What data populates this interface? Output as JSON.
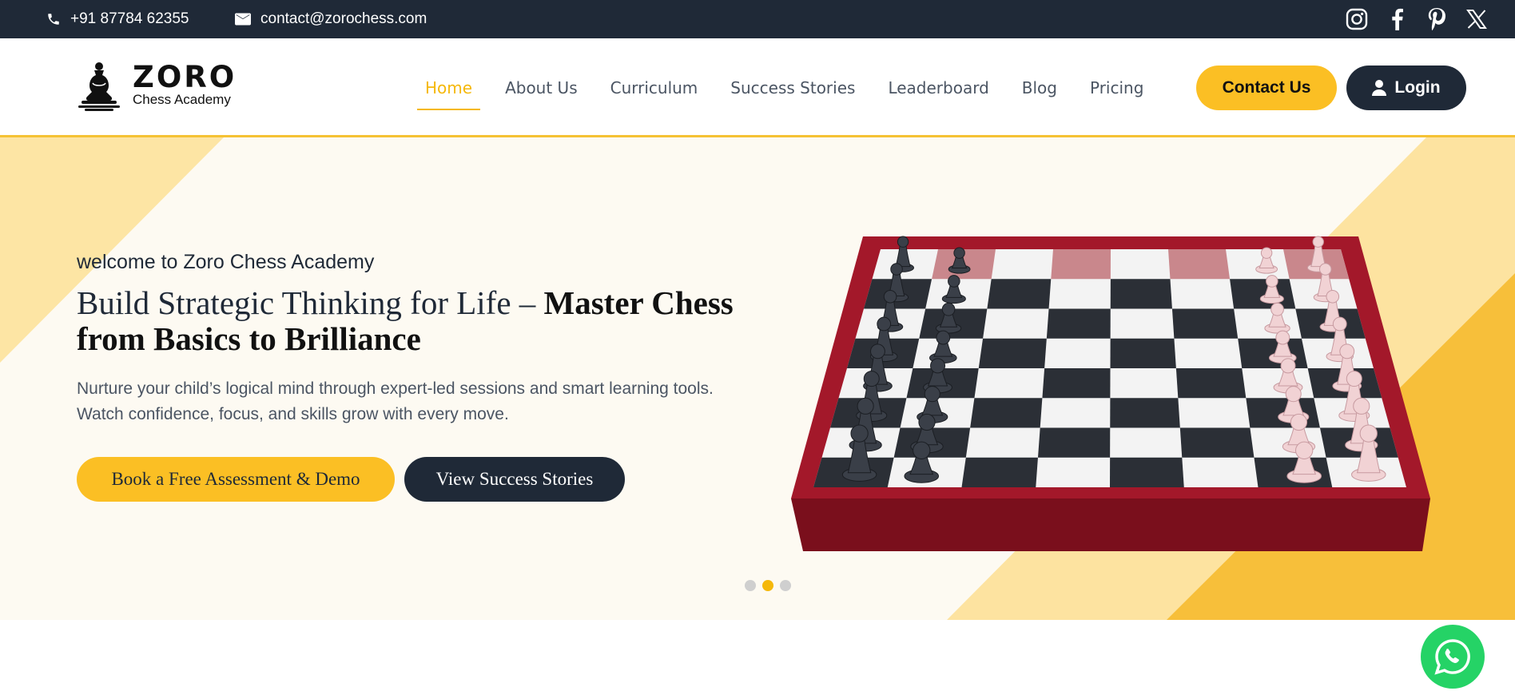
{
  "topbar": {
    "phone": "+91 87784 62355",
    "email": "contact@zorochess.com",
    "socials": [
      "instagram-icon",
      "facebook-icon",
      "pinterest-icon",
      "x-icon"
    ]
  },
  "brand": {
    "name": "ZORO",
    "subtitle": "Chess Academy"
  },
  "nav": {
    "items": [
      {
        "label": "Home",
        "active": true
      },
      {
        "label": "About Us"
      },
      {
        "label": "Curriculum"
      },
      {
        "label": "Success Stories"
      },
      {
        "label": "Leaderboard"
      },
      {
        "label": "Blog"
      },
      {
        "label": "Pricing"
      }
    ],
    "contact_label": "Contact Us",
    "login_label": "Login"
  },
  "hero": {
    "welcome": "welcome to Zoro Chess Academy",
    "headline_light": "Build Strategic Thinking for Life – ",
    "headline_bold": "Master Chess from Basics to Brilliance",
    "subtext_line1": "Nurture your child’s logical mind through expert-led sessions and smart learning tools.",
    "subtext_line2": "Watch confidence, focus, and skills grow with every move.",
    "primary_button": "Book a Free Assessment & Demo",
    "secondary_button": "View Success Stories",
    "carousel_active_index": 2,
    "carousel_count": 3
  },
  "colors": {
    "accent": "#fbbf24",
    "dark": "#1f2937",
    "whatsapp": "#25d366"
  }
}
